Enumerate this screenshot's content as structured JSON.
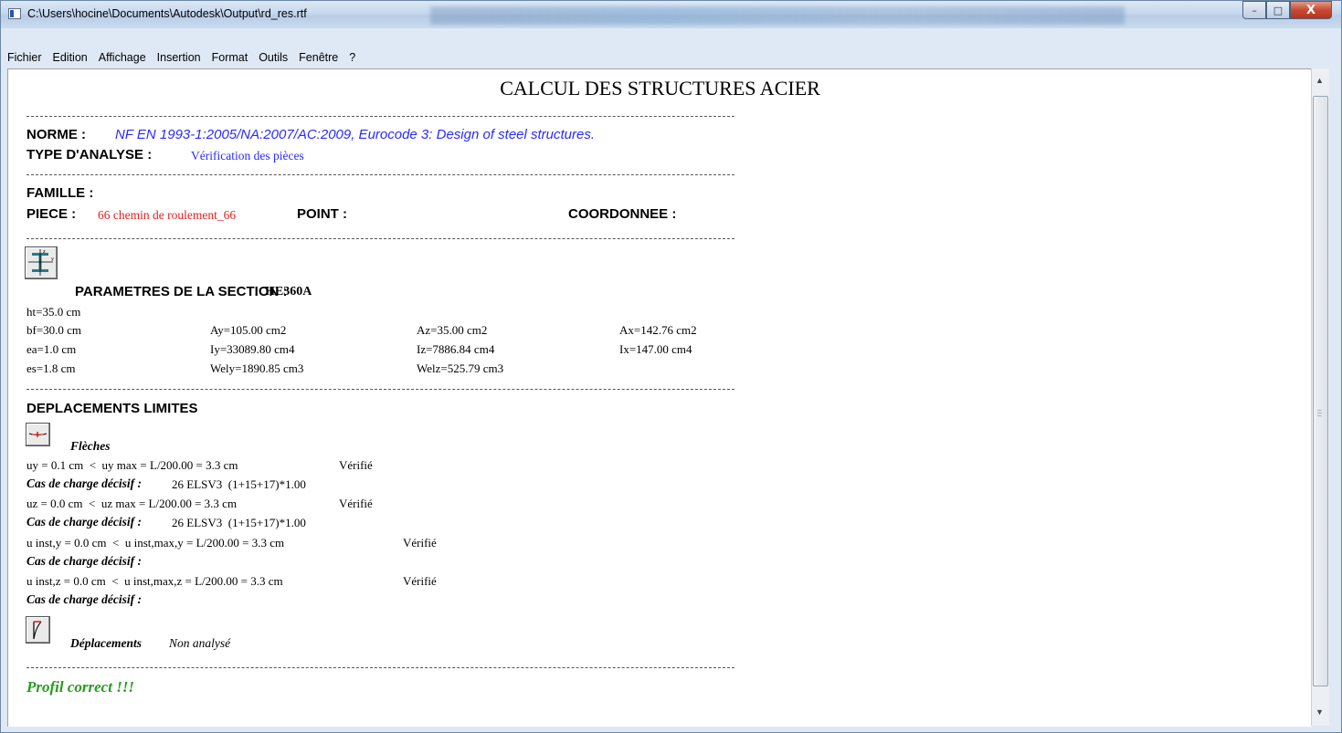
{
  "window": {
    "title": "C:\\Users\\hocine\\Documents\\Autodesk\\Output\\rd_res.rtf",
    "minimize": "–",
    "maximize": "□",
    "close": "X"
  },
  "menu": [
    "Fichier",
    "Edition",
    "Affichage",
    "Insertion",
    "Format",
    "Outils",
    "Fenêtre",
    "?"
  ],
  "doc": {
    "title": "CALCUL DES STRUCTURES ACIER",
    "norme_label": "NORME :",
    "norme_value": "NF EN 1993-1:2005/NA:2007/AC:2009,  Eurocode 3: Design of steel structures.",
    "analyse_label": "TYPE D'ANALYSE :",
    "analyse_value": "Vérification des pièces",
    "famille_label": "FAMILLE :",
    "piece_label": "PIECE :",
    "piece_value": "66  chemin de roulement_66",
    "point_label": "POINT :",
    "coord_label": "COORDONNEE :",
    "section_label": "PARAMETRES DE LA SECTION :",
    "section_value": "HE360A",
    "params": {
      "ht": "ht=35.0 cm",
      "bf": "bf=30.0 cm",
      "ea": "ea=1.0 cm",
      "es": "es=1.8 cm",
      "ay": "Ay=105.00 cm2",
      "iy": "Iy=33089.80 cm4",
      "wely": "Wely=1890.85 cm3",
      "az": "Az=35.00 cm2",
      "iz": "Iz=7886.84 cm4",
      "welz": "Welz=525.79 cm3",
      "ax": "Ax=142.76 cm2",
      "ix": "Ix=147.00 cm4"
    },
    "depl_label": "DEPLACEMENTS LIMITES",
    "fleches_label": "Flèches",
    "uy_line": "uy = 0.1 cm  <  uy max = L/200.00 = 3.3 cm",
    "verifie": "Vérifié",
    "cas_label": "Cas de charge décisif :",
    "cas_value": "26 ELSV3  (1+15+17)*1.00",
    "uz_line": "uz = 0.0 cm  <  uz max = L/200.00 = 3.3 cm",
    "uinsty_line": "u inst,y = 0.0 cm  <  u inst,max,y = L/200.00 = 3.3 cm",
    "uinstz_line": "u inst,z = 0.0 cm  <  u inst,max,z = L/200.00 = 3.3 cm",
    "deplacements_label": "Déplacements",
    "non_analyse": "Non analysé",
    "result": "Profil correct !!!"
  }
}
